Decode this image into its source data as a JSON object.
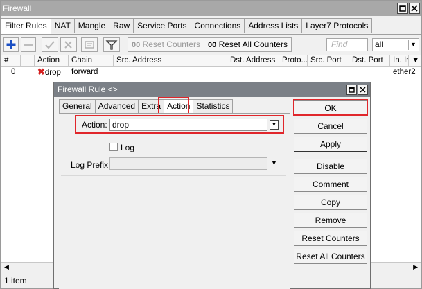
{
  "window": {
    "title": "Firewall"
  },
  "tabs": [
    "Filter Rules",
    "NAT",
    "Mangle",
    "Raw",
    "Service Ports",
    "Connections",
    "Address Lists",
    "Layer7 Protocols"
  ],
  "toolbar": {
    "reset_counters": "Reset Counters",
    "reset_all_counters": "Reset All Counters",
    "counter_prefix_1": "00",
    "counter_prefix_2": "00",
    "find_placeholder": "Find",
    "filter_value": "all"
  },
  "table": {
    "columns": [
      "#",
      "Action",
      "Chain",
      "Src. Address",
      "Dst. Address",
      "Proto...",
      "Src. Port",
      "Dst. Port",
      "In. In"
    ],
    "rows": [
      {
        "num": "0",
        "action": "drop",
        "chain": "forward",
        "in_interface": "ether2"
      }
    ]
  },
  "status": {
    "item_count": "1 item"
  },
  "dialog": {
    "title": "Firewall Rule <>",
    "tabs": [
      "General",
      "Advanced",
      "Extra",
      "Action",
      "Statistics"
    ],
    "active_tab": "Action",
    "action_label": "Action:",
    "action_value": "drop",
    "log_label": "Log",
    "log_prefix_label": "Log Prefix:",
    "log_prefix_value": "",
    "buttons": [
      "OK",
      "Cancel",
      "Apply",
      "Disable",
      "Comment",
      "Copy",
      "Remove",
      "Reset Counters",
      "Reset All Counters"
    ]
  },
  "colors": {
    "highlight": "#e0262b",
    "add_icon": "#1a4fc4",
    "drop_icon": "#d42020"
  }
}
